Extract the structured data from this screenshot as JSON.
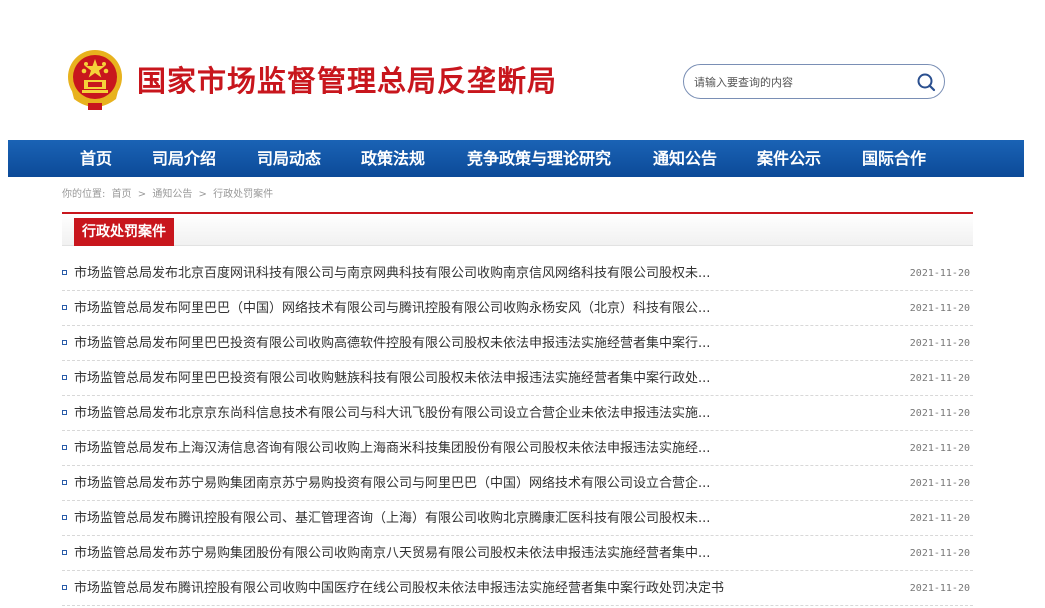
{
  "header": {
    "site_title": "国家市场监督管理总局反垄断局",
    "emblem_icon": "national-emblem-icon",
    "search": {
      "placeholder": "请输入要查询的内容",
      "button_icon": "search-icon"
    }
  },
  "nav": {
    "items": [
      {
        "label": "首页"
      },
      {
        "label": "司局介绍"
      },
      {
        "label": "司局动态"
      },
      {
        "label": "政策法规"
      },
      {
        "label": "竞争政策与理论研究"
      },
      {
        "label": "通知公告"
      },
      {
        "label": "案件公示"
      },
      {
        "label": "国际合作"
      }
    ]
  },
  "breadcrumb": {
    "prefix": "你的位置:",
    "items": [
      "首页",
      "通知公告",
      "行政处罚案件"
    ],
    "separator": ">"
  },
  "section": {
    "title": "行政处罚案件"
  },
  "news": [
    {
      "title": "市场监管总局发布北京百度网讯科技有限公司与南京网典科技有限公司收购南京信风网络科技有限公司股权未...",
      "date": "2021-11-20"
    },
    {
      "title": "市场监管总局发布阿里巴巴（中国）网络技术有限公司与腾讯控股有限公司收购永杨安风（北京）科技有限公...",
      "date": "2021-11-20"
    },
    {
      "title": "市场监管总局发布阿里巴巴投资有限公司收购高德软件控股有限公司股权未依法申报违法实施经营者集中案行...",
      "date": "2021-11-20"
    },
    {
      "title": "市场监管总局发布阿里巴巴投资有限公司收购魅族科技有限公司股权未依法申报违法实施经营者集中案行政处...",
      "date": "2021-11-20"
    },
    {
      "title": "市场监管总局发布北京京东尚科信息技术有限公司与科大讯飞股份有限公司设立合营企业未依法申报违法实施...",
      "date": "2021-11-20"
    },
    {
      "title": "市场监管总局发布上海汉涛信息咨询有限公司收购上海商米科技集团股份有限公司股权未依法申报违法实施经...",
      "date": "2021-11-20"
    },
    {
      "title": "市场监管总局发布苏宁易购集团南京苏宁易购投资有限公司与阿里巴巴（中国）网络技术有限公司设立合营企...",
      "date": "2021-11-20"
    },
    {
      "title": "市场监管总局发布腾讯控股有限公司、基汇管理咨询（上海）有限公司收购北京腾康汇医科技有限公司股权未...",
      "date": "2021-11-20"
    },
    {
      "title": "市场监管总局发布苏宁易购集团股份有限公司收购南京八天贸易有限公司股权未依法申报违法实施经营者集中...",
      "date": "2021-11-20"
    },
    {
      "title": "市场监管总局发布腾讯控股有限公司收购中国医疗在线公司股权未依法申报违法实施经营者集中案行政处罚决定书",
      "date": "2021-11-20"
    }
  ],
  "colors": {
    "brand_red": "#c8161d",
    "nav_blue": "#0c4a98"
  }
}
